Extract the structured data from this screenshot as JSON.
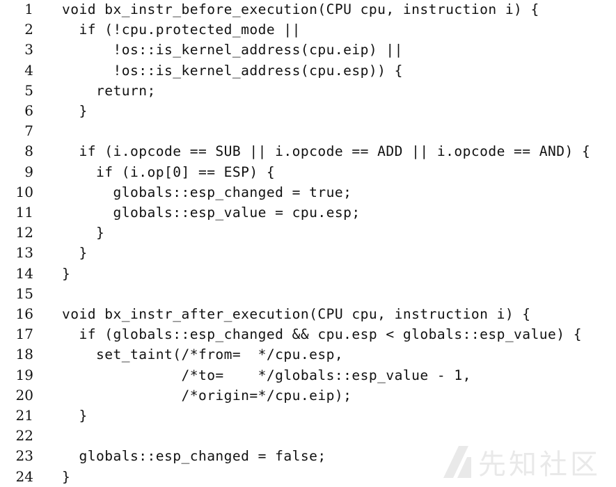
{
  "code": {
    "lines": [
      {
        "num": "1",
        "text": "void bx_instr_before_execution(CPU cpu, instruction i) {"
      },
      {
        "num": "2",
        "text": "  if (!cpu.protected_mode ||"
      },
      {
        "num": "3",
        "text": "      !os::is_kernel_address(cpu.eip) ||"
      },
      {
        "num": "4",
        "text": "      !os::is_kernel_address(cpu.esp)) {"
      },
      {
        "num": "5",
        "text": "    return;"
      },
      {
        "num": "6",
        "text": "  }"
      },
      {
        "num": "7",
        "text": ""
      },
      {
        "num": "8",
        "text": "  if (i.opcode == SUB || i.opcode == ADD || i.opcode == AND) {"
      },
      {
        "num": "9",
        "text": "    if (i.op[0] == ESP) {"
      },
      {
        "num": "10",
        "text": "      globals::esp_changed = true;"
      },
      {
        "num": "11",
        "text": "      globals::esp_value = cpu.esp;"
      },
      {
        "num": "12",
        "text": "    }"
      },
      {
        "num": "13",
        "text": "  }"
      },
      {
        "num": "14",
        "text": "}"
      },
      {
        "num": "15",
        "text": ""
      },
      {
        "num": "16",
        "text": "void bx_instr_after_execution(CPU cpu, instruction i) {"
      },
      {
        "num": "17",
        "text": "  if (globals::esp_changed && cpu.esp < globals::esp_value) {"
      },
      {
        "num": "18",
        "text": "    set_taint(/*from=  */cpu.esp,"
      },
      {
        "num": "19",
        "text": "              /*to=    */globals::esp_value - 1,"
      },
      {
        "num": "20",
        "text": "              /*origin=*/cpu.eip);"
      },
      {
        "num": "21",
        "text": "  }"
      },
      {
        "num": "22",
        "text": ""
      },
      {
        "num": "23",
        "text": "  globals::esp_changed = false;"
      },
      {
        "num": "24",
        "text": "}"
      }
    ]
  },
  "watermark": {
    "text": "先知社区",
    "icon": "slash-logo-icon"
  }
}
